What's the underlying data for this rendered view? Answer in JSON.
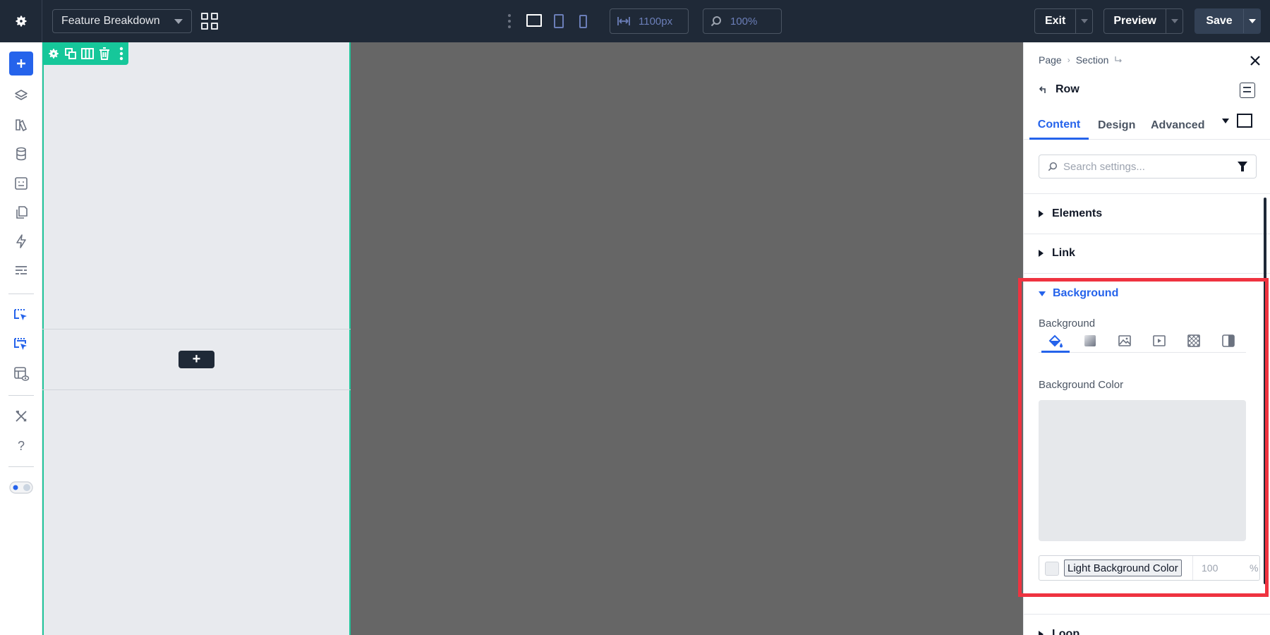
{
  "topbar": {
    "page_name": "Feature Breakdown",
    "width_value": "1100px",
    "zoom_value": "100%",
    "exit_label": "Exit",
    "preview_label": "Preview",
    "save_label": "Save"
  },
  "canvas": {
    "add_module_label": "+"
  },
  "panel": {
    "breadcrumb": [
      "Page",
      "Section"
    ],
    "title": "Row",
    "tabs": [
      "Content",
      "Design",
      "Advanced"
    ],
    "active_tab": "Content",
    "search_placeholder": "Search settings...",
    "sections": {
      "elements": "Elements",
      "link": "Link",
      "background": "Background",
      "loop": "Loop"
    },
    "background": {
      "field_label": "Background",
      "color_label": "Background Color",
      "color_name": "Light Background Color",
      "opacity": "100",
      "opacity_unit": "%"
    }
  },
  "colors": {
    "accent": "#2563eb",
    "topbar": "#1f2937",
    "row_outline": "#22c59a",
    "highlight": "#ef3340"
  }
}
